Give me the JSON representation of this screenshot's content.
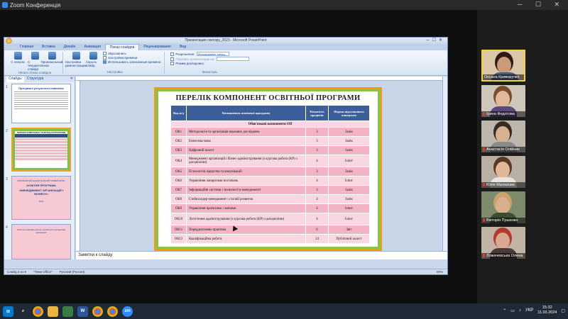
{
  "zoom": {
    "title": "Zoom Конференція"
  },
  "ppt": {
    "title": "Презентация сектору_2023 - Microsoft PowerPoint",
    "tabs": [
      "Главная",
      "Вставка",
      "Дизайн",
      "Анимация",
      "Показ слайдов",
      "Рецензирование",
      "Вид"
    ],
    "active_tab": "Показ слайдов",
    "ribbon": {
      "groups": [
        {
          "name": "Начать показ слайдов",
          "buttons": [
            "С начала",
            "С текущего слайда",
            "Произвольный показ"
          ]
        },
        {
          "name": "Настройка",
          "buttons": [
            "Настройка демонстрации",
            "Скрыть слайд"
          ],
          "options": [
            "Звукозапись",
            "Настройка времени",
            "Использовать записанные времена"
          ]
        },
        {
          "name": "Мониторы",
          "options": [
            "Разрешение:",
            "Показать презентацию на:",
            "Режим докладчика"
          ],
          "resolution_value": "Использовать текущ..."
        }
      ]
    },
    "pane_tabs": [
      "Слайды",
      "Структура"
    ],
    "thumb_numbers": [
      "1",
      "2",
      "3",
      "4"
    ],
    "thumb1": {
      "title": "Програмні результати навчання"
    },
    "thumb2": {
      "title": "ПЕРЕЛІК КОМПОНЕНТ ОСВІТНЬОЇ ПРОГРАМИ"
    },
    "thumb3": {
      "l1": "ЗАПОРІЗЬКИЙ НАЦІОНАЛЬНИЙ УНІВЕРСИТЕТ",
      "l2": "ОСВІТНЯ ПРОГРАМА",
      "l3": "«МЕНЕДЖМЕНТ ОРГАНІЗАЦІЙ І БІЗНЕСУ»",
      "l4": "2024"
    },
    "thumb4": {
      "text": "Освітня програма високо оцінюється провідними фахівцями"
    },
    "slide": {
      "title": "ПЕРЕЛІК КОМПОНЕНТ ОСВІТНЬОЇ ПРОГРАМИ",
      "headers": [
        "Код н/д",
        "Компоненти освітньої програми",
        "Кількість кредитів",
        "Форма підсумкового контролю"
      ],
      "subhead": "Обов'язкові компоненти ОП",
      "rows": [
        {
          "code": "ОК1",
          "name": "Методологія та організація наукових досліджень",
          "credits": "3",
          "form": "Залік"
        },
        {
          "code": "ОК2",
          "name": "Бізнесова мова",
          "credits": "3",
          "form": "Залік"
        },
        {
          "code": "ОК3",
          "name": "Цифровий захист",
          "credits": "3",
          "form": "Залік"
        },
        {
          "code": "ОК4",
          "name": "Менеджмент організацій і бізнес-адміністрування (з курсова робота (КР) з дисципліни)",
          "credits": "4",
          "form": "Іспит"
        },
        {
          "code": "ОК5",
          "name": "Психологія лідерства та комунікацій",
          "credits": "3",
          "form": "Залік"
        },
        {
          "code": "ОК6",
          "name": "Управління ланцюгами постачань",
          "credits": "4",
          "form": "Іспит"
        },
        {
          "code": "ОК7",
          "name": "Інформаційні системи і технології в менеджменті",
          "credits": "3",
          "form": "Залік"
        },
        {
          "code": "ОК8",
          "name": "Стейкхолдер-менеджмент і сталий розвиток",
          "credits": "4",
          "form": "Залік"
        },
        {
          "code": "ОК9",
          "name": "Управління проектами і змінами",
          "credits": "4",
          "form": "Іспит"
        },
        {
          "code": "ОК10",
          "name": "Логістичне адміністрування (з курсова робота (КР) з дисципліни)",
          "credits": "4",
          "form": "Іспит"
        },
        {
          "code": "ОК11",
          "name": "Переддипломна практика",
          "credits": "6",
          "form": "Звіт"
        },
        {
          "code": "ОК12",
          "name": "Кваліфікаційна робота",
          "credits": "24",
          "form": "Публічний захист"
        }
      ]
    },
    "notes_placeholder": "Заметки к слайду",
    "status": {
      "slide": "Слайд 2 из 9",
      "theme": "\"Тема Office\"",
      "lang": "Русский (Россия)",
      "zoom": "69%"
    }
  },
  "participants": [
    {
      "name": "Оксана Криворучко",
      "active": true,
      "muted": false,
      "bg": "#d9c7a8",
      "skin": "#c89b7b",
      "hair": "#2b1b12",
      "shirt": "#4c5d7a"
    },
    {
      "name": "Ірина Федотова",
      "active": false,
      "muted": true,
      "bg": "#cfc6bb",
      "skin": "#e2b99c",
      "hair": "#7a4e2d",
      "shirt": "#5a4a7a"
    },
    {
      "name": "Анастасія Олійник",
      "active": false,
      "muted": true,
      "bg": "#bdb6ad",
      "skin": "#d8b190",
      "hair": "#3a2a22",
      "shirt": "#8a8a8a"
    },
    {
      "name": "Юлія Малахова",
      "active": false,
      "muted": true,
      "bg": "#b8b0a4",
      "skin": "#e0b898",
      "hair": "#5b3a24",
      "shirt": "#e8e4de"
    },
    {
      "name": "Вікторія Пушенко",
      "active": false,
      "muted": true,
      "bg": "#7d8a6b",
      "skin": "#d9b08c",
      "hair": "#c9a26a",
      "shirt": "#3d4c33"
    },
    {
      "name": "Ложачевська Олена",
      "active": false,
      "muted": true,
      "bg": "#c2b3a7",
      "skin": "#d8a890",
      "hair": "#b23a2a",
      "shirt": "#4a3a3a"
    }
  ],
  "taskbar": {
    "lang": "УКР",
    "time": "15:32",
    "date": "11.03.2024",
    "icons": [
      "start-icon",
      "search-icon",
      "chrome-icon",
      "explorer-icon",
      "app-icon",
      "word-icon",
      "chrome-icon",
      "chrome-icon",
      "zoom-icon"
    ]
  }
}
